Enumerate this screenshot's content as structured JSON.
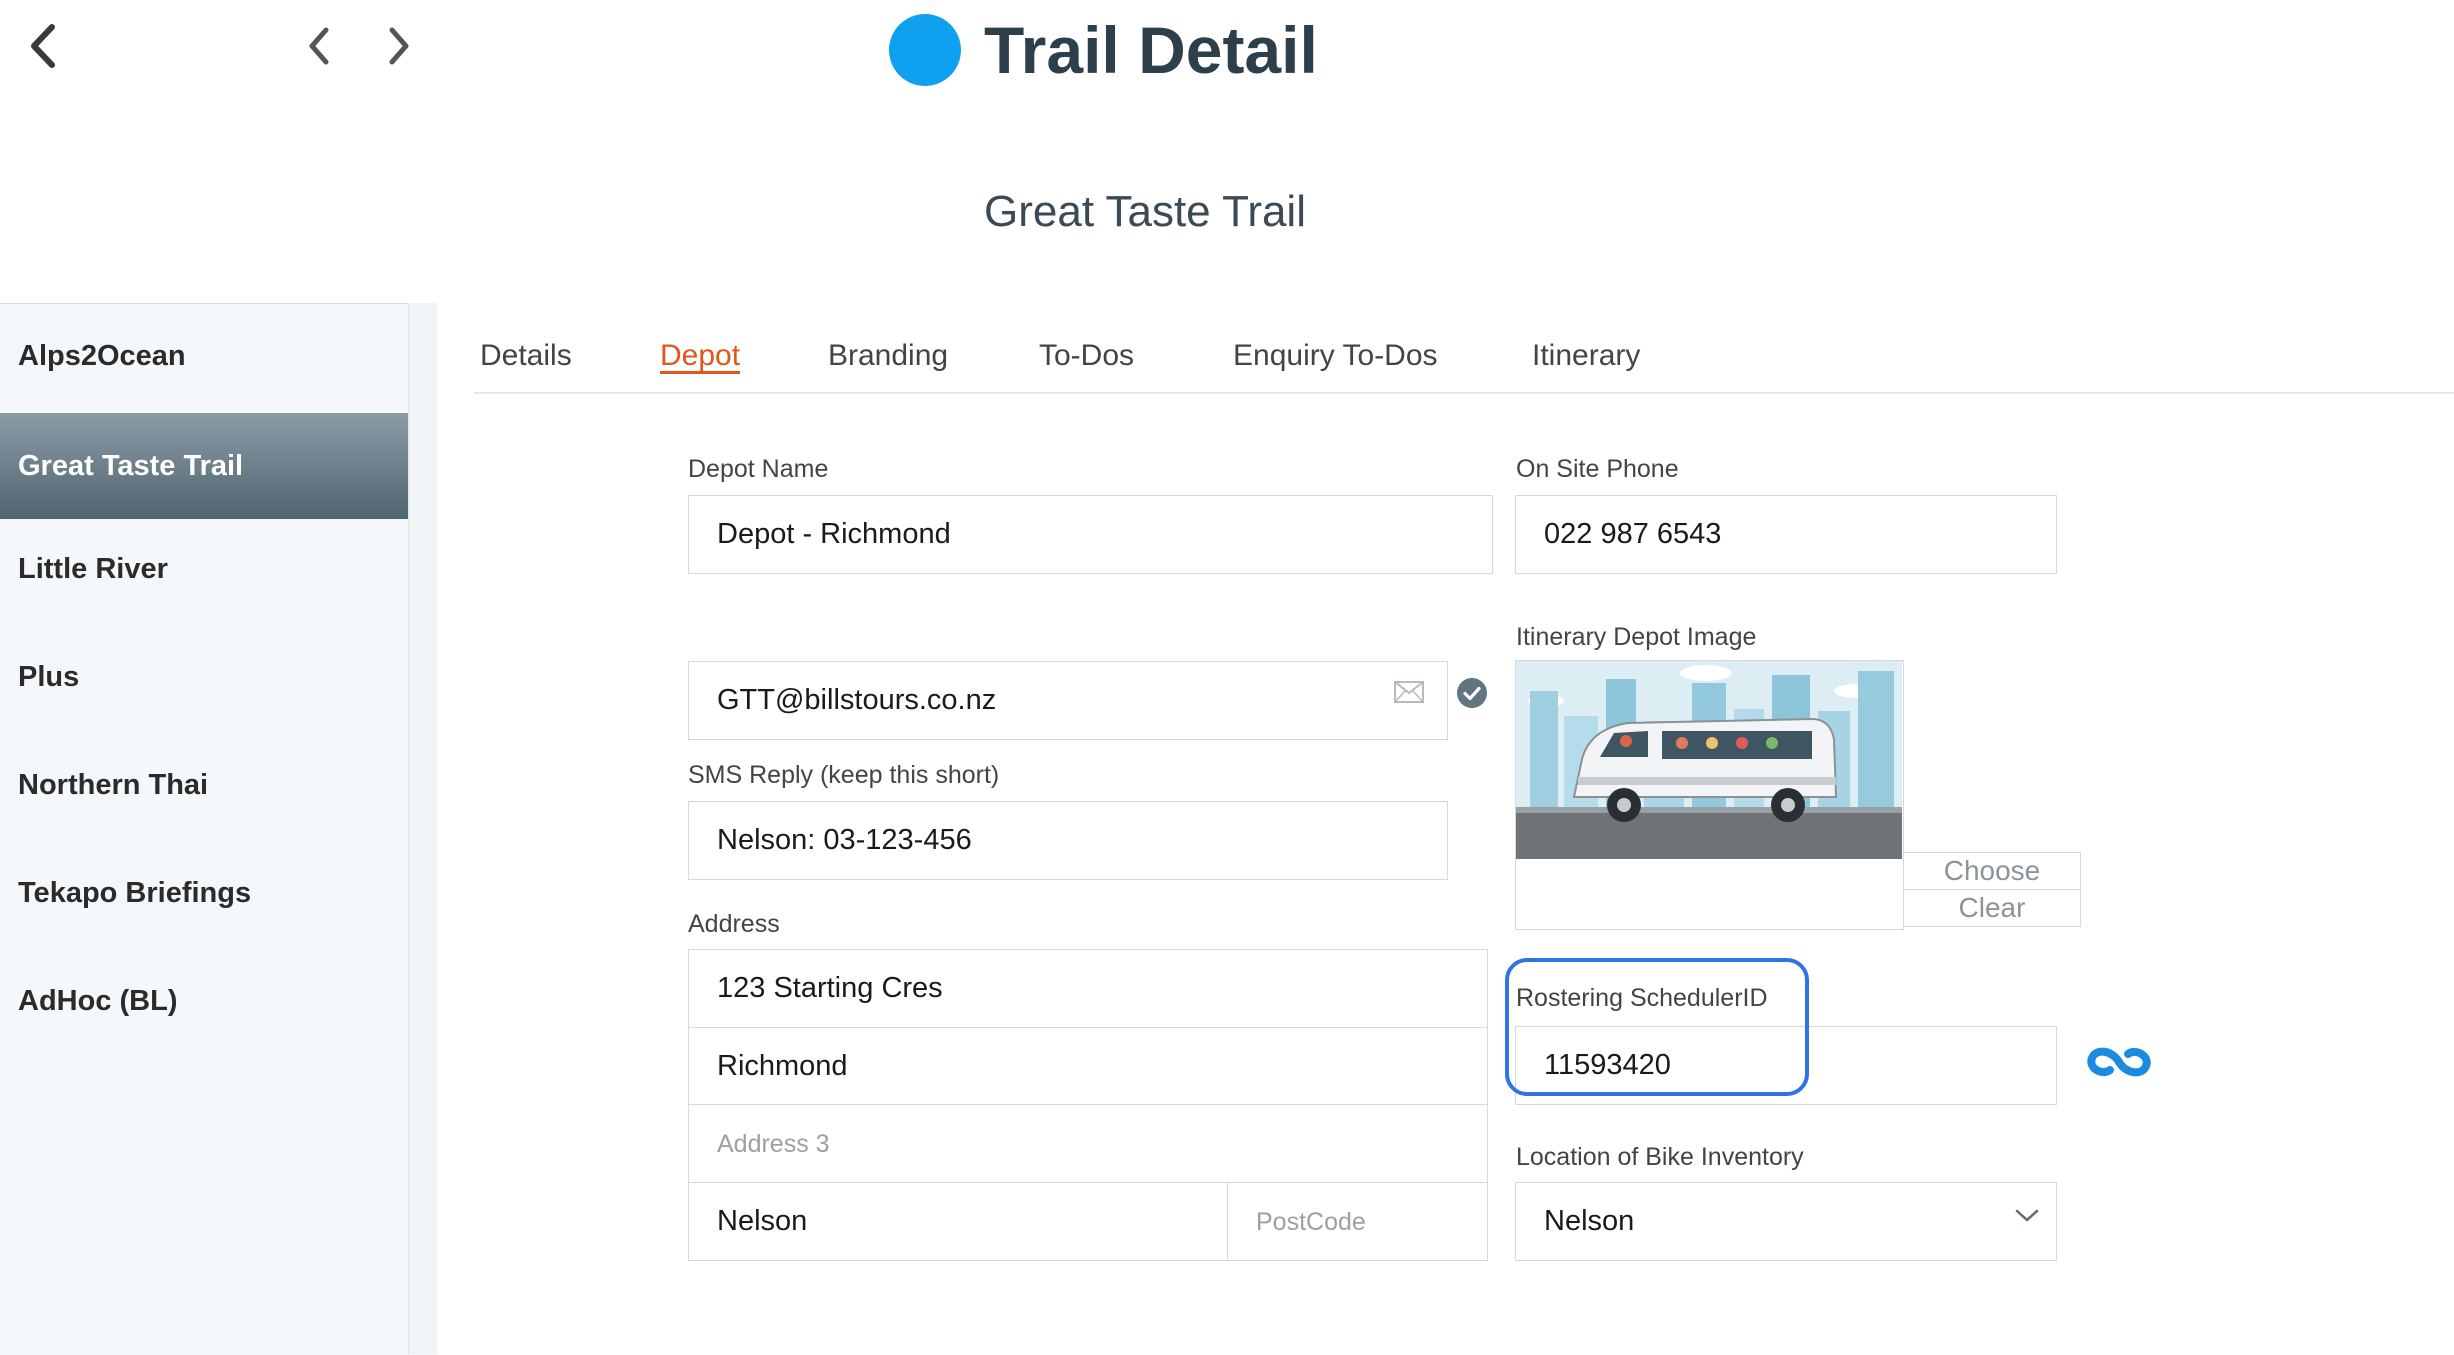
{
  "header": {
    "title": "Trail Detail",
    "subtitle": "Great Taste Trail",
    "title_dot_color": "#0fa0ef"
  },
  "sidebar": {
    "items": [
      {
        "label": "Alps2Ocean",
        "active": false
      },
      {
        "label": "Great Taste Trail",
        "active": true
      },
      {
        "label": "Little River",
        "active": false
      },
      {
        "label": "Plus",
        "active": false
      },
      {
        "label": "Northern Thai",
        "active": false
      },
      {
        "label": "Tekapo Briefings",
        "active": false
      },
      {
        "label": "AdHoc (BL)",
        "active": false
      }
    ]
  },
  "tabs": [
    {
      "label": "Details",
      "active": false
    },
    {
      "label": "Depot",
      "active": true
    },
    {
      "label": "Branding",
      "active": false
    },
    {
      "label": "To-Dos",
      "active": false
    },
    {
      "label": "Enquiry To-Dos",
      "active": false
    },
    {
      "label": "Itinerary",
      "active": false
    }
  ],
  "form": {
    "depot_name": {
      "label": "Depot Name",
      "value": "Depot - Richmond"
    },
    "on_site_phone": {
      "label": "On Site Phone",
      "value": "022 987 6543"
    },
    "email": {
      "value": "GTT@billstours.co.nz"
    },
    "sms_reply": {
      "label": "SMS Reply (keep this short)",
      "value": "Nelson: 03-123-456"
    },
    "address": {
      "label": "Address",
      "line1": "123 Starting Cres",
      "line2": "Richmond",
      "line3_placeholder": "Address 3",
      "city": "Nelson",
      "postcode_placeholder": "PostCode"
    },
    "itinerary_image": {
      "label": "Itinerary Depot Image",
      "choose_label": "Choose",
      "clear_label": "Clear"
    },
    "rostering": {
      "label": "Rostering SchedulerID",
      "value": "11593420"
    },
    "bike_location": {
      "label": "Location of Bike Inventory",
      "value": "Nelson"
    }
  },
  "colors": {
    "accent_tab": "#e2551b",
    "link_icon": "#1a8be0",
    "highlight_border": "#2f74e6",
    "verified_check": "#5f7580"
  }
}
